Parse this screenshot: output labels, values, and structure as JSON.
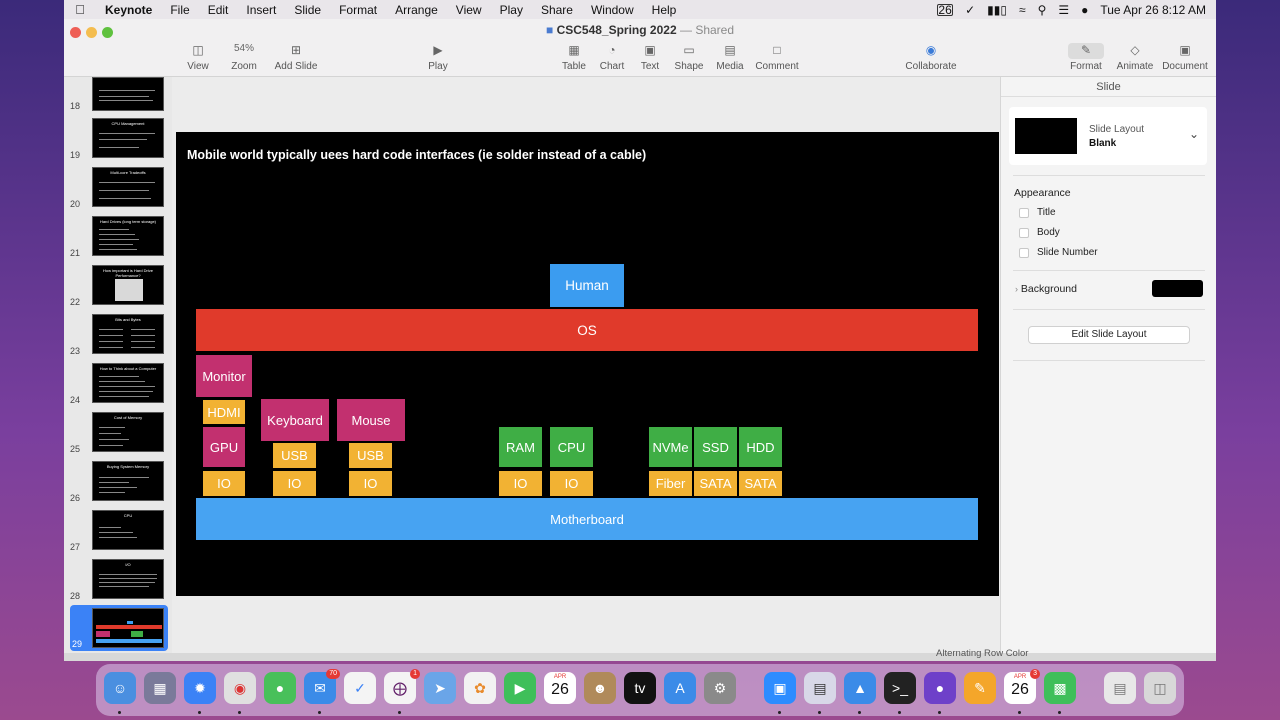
{
  "menubar": {
    "app": "Keynote",
    "items": [
      "File",
      "Edit",
      "Insert",
      "Slide",
      "Format",
      "Arrange",
      "View",
      "Play",
      "Share",
      "Window",
      "Help"
    ],
    "calendar_badge": "26",
    "datetime": "Tue Apr 26  8:12 AM"
  },
  "window": {
    "doc_title": "CSC548_Spring 2022",
    "separator": "—",
    "share_status": "Shared"
  },
  "toolbar": {
    "view": "View",
    "zoom_value": "54%",
    "zoom": "Zoom",
    "add_slide": "Add Slide",
    "play": "Play",
    "table": "Table",
    "chart": "Chart",
    "text": "Text",
    "shape": "Shape",
    "media": "Media",
    "comment": "Comment",
    "collaborate": "Collaborate",
    "format": "Format",
    "animate": "Animate",
    "document": "Document"
  },
  "slides": [
    {
      "num": "18"
    },
    {
      "num": "19",
      "title": "CPU Management"
    },
    {
      "num": "20",
      "title": "Multi-core Tradeoffs"
    },
    {
      "num": "21",
      "title": "Hard Drives (long term storage)"
    },
    {
      "num": "22",
      "title": "How important is Hard Drive Performance?"
    },
    {
      "num": "23",
      "title": "Bits and Bytes"
    },
    {
      "num": "24",
      "title": "How to Think about a Computer"
    },
    {
      "num": "25",
      "title": "Cost of Memory"
    },
    {
      "num": "26",
      "title": "Buying System Memory"
    },
    {
      "num": "27",
      "title": "CPU"
    },
    {
      "num": "28",
      "title": "I/O"
    },
    {
      "num": "29"
    }
  ],
  "slide": {
    "title": "Mobile world typically uees hard code interfaces (ie solder instead of a cable)",
    "human": "Human",
    "os": "OS",
    "monitor": "Monitor",
    "hdmi": "HDMI",
    "gpu": "GPU",
    "keyboard": "Keyboard",
    "mouse": "Mouse",
    "usb": "USB",
    "io": "IO",
    "ram": "RAM",
    "cpu": "CPU",
    "nvme": "NVMe",
    "ssd": "SSD",
    "hdd": "HDD",
    "fiber": "Fiber",
    "sata": "SATA",
    "motherboard": "Motherboard"
  },
  "inspector": {
    "header": "Slide",
    "layout_label": "Slide Layout",
    "layout_value": "Blank",
    "appearance": "Appearance",
    "title_opt": "Title",
    "body_opt": "Body",
    "slide_number_opt": "Slide Number",
    "background": "Background",
    "edit_layout": "Edit Slide Layout"
  },
  "behind_window_text": "Alternating Row Color",
  "dock": {
    "mail_badge": "70",
    "slack_badge": "1",
    "calendar_month": "APR",
    "calendar_day": "26",
    "calendar2_badge": "3",
    "calendar_badge": "26"
  },
  "colors": {
    "os_red": "#e03a2b",
    "human_blue": "#3b9cf0",
    "magenta": "#c2306f",
    "yellow": "#f2b233",
    "green": "#3fae45",
    "motherboard_blue": "#47a3f2"
  }
}
